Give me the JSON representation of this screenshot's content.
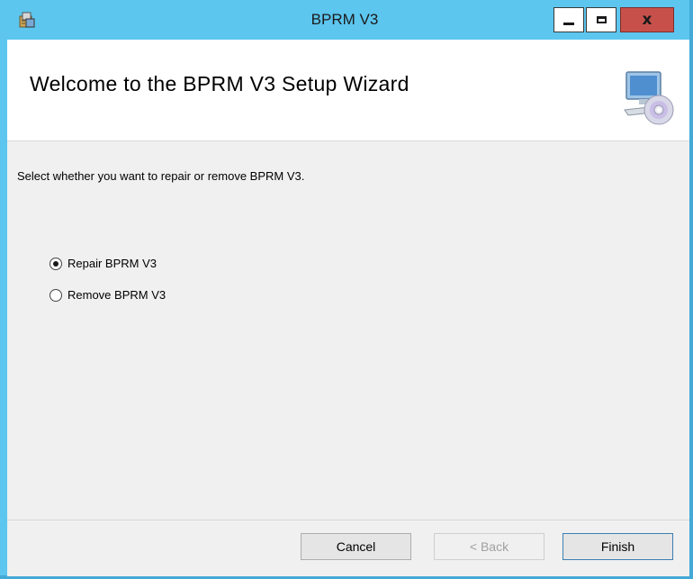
{
  "window": {
    "title": "BPRM V3",
    "controls": {
      "minimize": "minimize",
      "maximize": "maximize",
      "close": "x"
    }
  },
  "header": {
    "title": "Welcome to the BPRM V3 Setup Wizard",
    "icon": "computer-with-cd-icon"
  },
  "content": {
    "prompt": "Select whether you want to repair or remove BPRM V3.",
    "options": [
      {
        "label": "Repair BPRM V3",
        "selected": true
      },
      {
        "label": "Remove BPRM V3",
        "selected": false
      }
    ]
  },
  "footer": {
    "cancel": "Cancel",
    "back": "< Back",
    "back_enabled": false,
    "finish": "Finish"
  },
  "colors": {
    "titlebar": "#5cc6ef",
    "close_button": "#c7504b"
  }
}
